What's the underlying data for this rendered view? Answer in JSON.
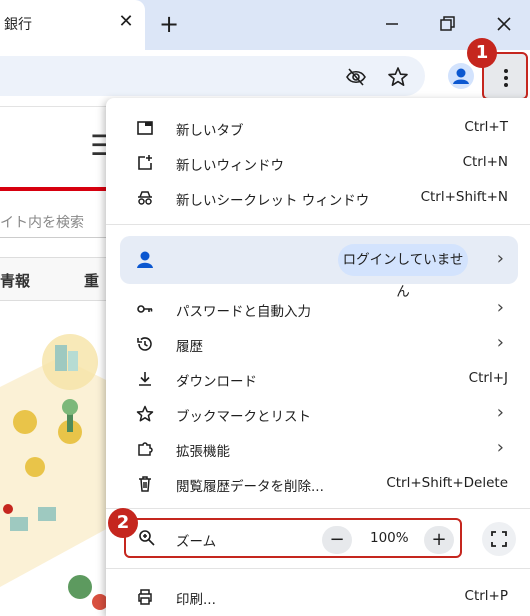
{
  "tab": {
    "title": "銀行",
    "close_label": "✕",
    "new_tab_label": "+"
  },
  "window_controls": {
    "minimize": "—",
    "restore": "❐",
    "close": "✕"
  },
  "page_background": {
    "search_placeholder": "イト内を検索",
    "nav": [
      "青報",
      "重"
    ]
  },
  "badges": {
    "menu_badge": "1",
    "zoom_badge": "2"
  },
  "menu": {
    "items": [
      {
        "icon": "new-tab-icon",
        "label": "新しいタブ",
        "shortcut": "Ctrl+T"
      },
      {
        "icon": "new-window-icon",
        "label": "新しいウィンドウ",
        "shortcut": "Ctrl+N"
      },
      {
        "icon": "incognito-icon",
        "label": "新しいシークレット ウィンドウ",
        "shortcut": "Ctrl+Shift+N"
      }
    ],
    "profile": {
      "status": "ログインしていません"
    },
    "items2": [
      {
        "icon": "key-icon",
        "label": "パスワードと自動入力",
        "arrow": "›"
      },
      {
        "icon": "history-icon",
        "label": "履歴",
        "arrow": "›"
      },
      {
        "icon": "download-icon",
        "label": "ダウンロード",
        "shortcut": "Ctrl+J"
      },
      {
        "icon": "star-icon",
        "label": "ブックマークとリスト",
        "arrow": "›"
      },
      {
        "icon": "extensions-icon",
        "label": "拡張機能",
        "arrow": "›"
      },
      {
        "icon": "trash-icon",
        "label": "閲覧履歴データを削除...",
        "shortcut": "Ctrl+Shift+Delete"
      }
    ],
    "zoom": {
      "label": "ズーム",
      "value": "100%",
      "minus": "−",
      "plus": "+"
    },
    "print": {
      "label": "印刷...",
      "shortcut": "Ctrl+P"
    }
  },
  "colors": {
    "accent_red": "#c5261e",
    "titlebar": "#dce6f7",
    "profile_blue": "#0b57d0"
  }
}
